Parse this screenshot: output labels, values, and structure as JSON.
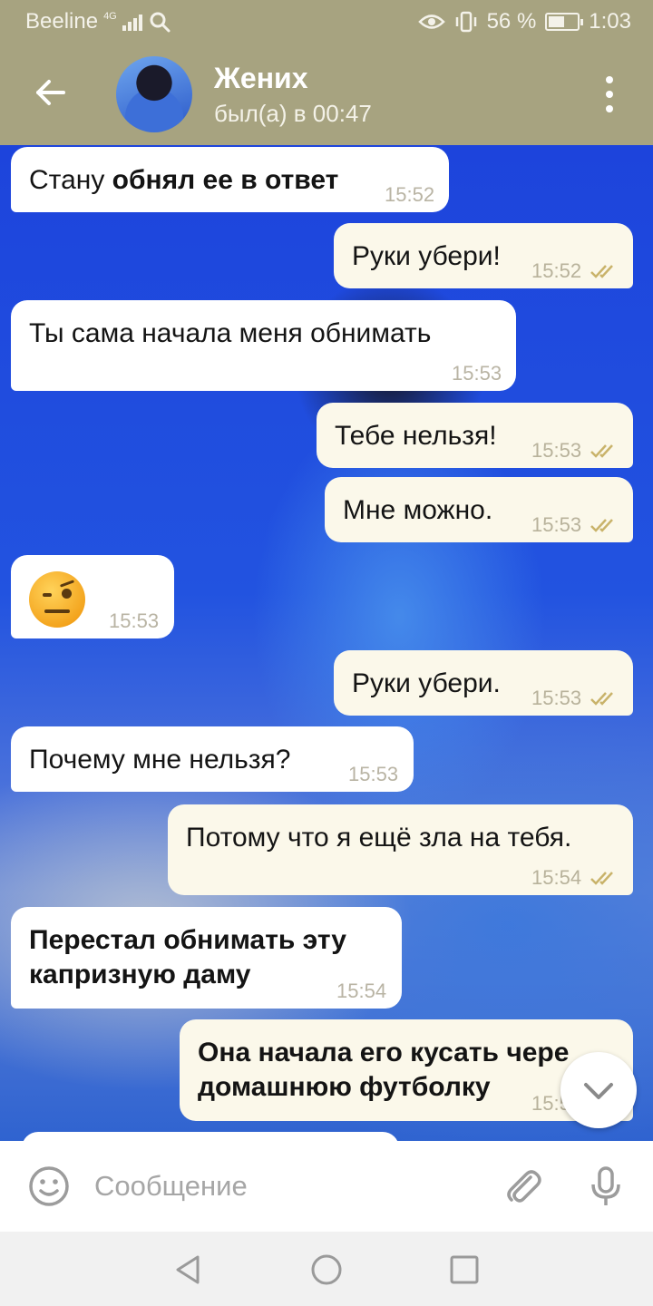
{
  "status_bar": {
    "carrier": "Beeline",
    "network": "4G",
    "battery_percent": "56 %",
    "battery_level": 0.56,
    "time": "1:03",
    "icons": [
      "search-icon",
      "eye-icon",
      "vibrate-icon",
      "battery-icon"
    ]
  },
  "header": {
    "contact_name": "Жених",
    "last_seen": "был(а) в 00:47",
    "icons": [
      "back-arrow-icon",
      "more-vertical-icon"
    ]
  },
  "messages": [
    {
      "direction": "in",
      "text": "Стану",
      "bold": "обнял ее в ответ",
      "time": "15:52"
    },
    {
      "direction": "out",
      "text": "Руки убери!",
      "time": "15:52",
      "read": true
    },
    {
      "direction": "in",
      "text": "Ты сама начала меня обнимать",
      "time": "15:53"
    },
    {
      "direction": "out",
      "text": "Тебе нельзя!",
      "time": "15:53",
      "read": true
    },
    {
      "direction": "out",
      "text": "Мне можно.",
      "time": "15:53",
      "read": true
    },
    {
      "direction": "in",
      "emoji": "raised-eyebrow-face",
      "time": "15:53"
    },
    {
      "direction": "out",
      "text": "Руки убери.",
      "time": "15:53",
      "read": true
    },
    {
      "direction": "in",
      "text": "Почему мне нельзя?",
      "time": "15:53"
    },
    {
      "direction": "out",
      "text": "Потому что я ещё зла на тебя.",
      "time": "15:54",
      "read": true
    },
    {
      "direction": "in",
      "bold": "Перестал обнимать эту капризную даму",
      "time": "15:54"
    },
    {
      "direction": "out",
      "bold": "Она начала его кусать через домашнюю футболку",
      "visible_bold": "Она начала его кусать чере домашнюю футболку",
      "time_visible": "15:5"
    }
  ],
  "input": {
    "placeholder": "Сообщение",
    "icons": [
      "emoji-icon",
      "attach-icon",
      "microphone-icon"
    ]
  },
  "nav": {
    "icons": [
      "back-triangle-icon",
      "home-circle-icon",
      "recents-square-icon"
    ]
  },
  "colors": {
    "header_bg": "#a7a380",
    "incoming_bubble": "#ffffff",
    "outgoing_bubble": "#fbf8ea",
    "check_color": "#c9b36a"
  }
}
